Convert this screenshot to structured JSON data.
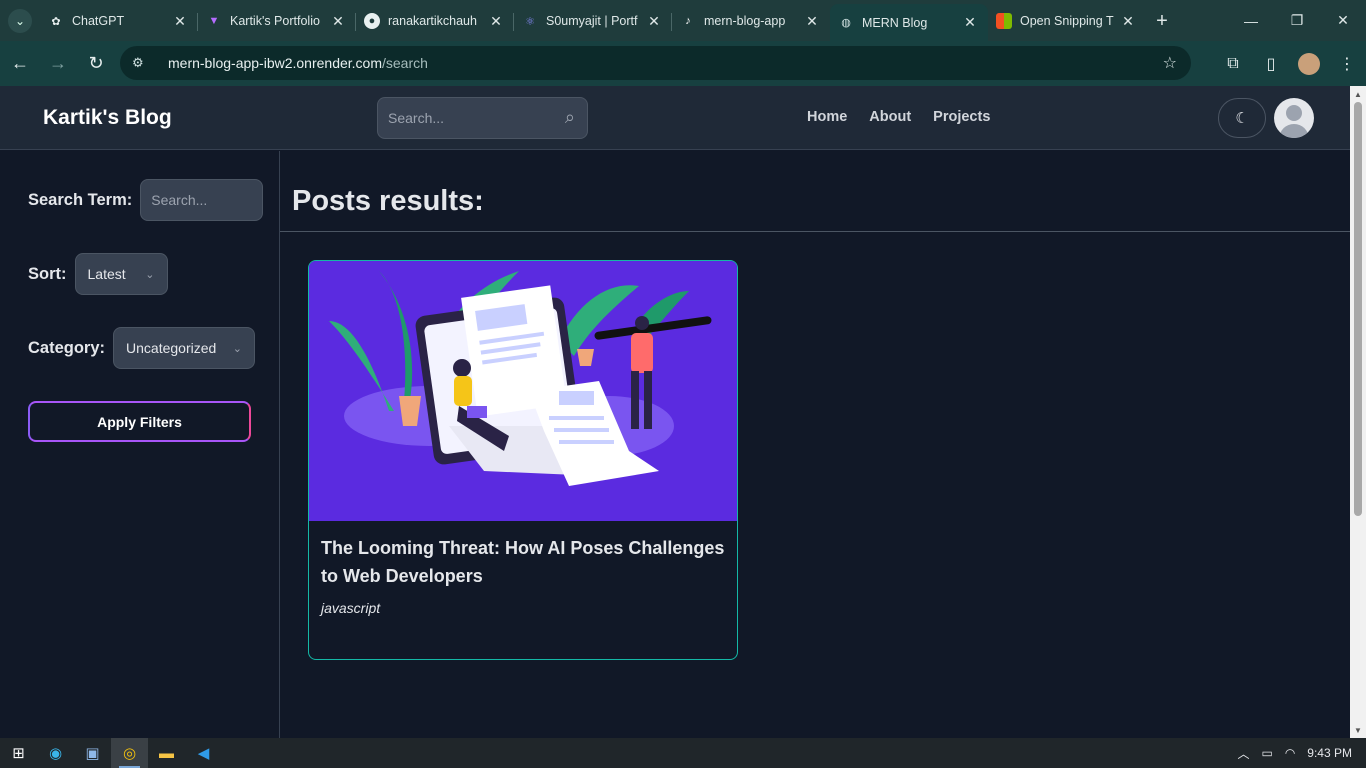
{
  "browser": {
    "tabs": [
      {
        "label": "ChatGPT",
        "icon": "chatgpt-icon",
        "active": false
      },
      {
        "label": "Kartik's Portfolio",
        "icon": "vite-icon",
        "active": false
      },
      {
        "label": "ranakartikchauh",
        "icon": "github-icon",
        "active": false
      },
      {
        "label": "S0umyajit | Portf",
        "icon": "react-icon",
        "active": false
      },
      {
        "label": "mern-blog-app",
        "icon": "render-icon",
        "active": false
      },
      {
        "label": "MERN Blog",
        "icon": "globe-icon",
        "active": true
      },
      {
        "label": "Open Snipping T",
        "icon": "microsoft-icon",
        "active": false
      }
    ],
    "url_host": "mern-blog-app-ibw2.onrender.com",
    "url_path": "/search"
  },
  "header": {
    "brand": "Kartik's Blog",
    "search_placeholder": "Search...",
    "nav": [
      "Home",
      "About",
      "Projects"
    ]
  },
  "sidebar": {
    "search_label": "Search Term:",
    "search_placeholder": "Search...",
    "sort_label": "Sort:",
    "sort_value": "Latest",
    "category_label": "Category:",
    "category_value": "Uncategorized",
    "apply_label": "Apply Filters"
  },
  "main": {
    "title": "Posts results:",
    "posts": [
      {
        "title": "The Looming Threat: How AI Poses Challenges to Web Developers",
        "category": "javascript"
      }
    ]
  },
  "taskbar": {
    "clock": "9:43 PM"
  },
  "colors": {
    "page_bg": "#111827",
    "header_bg": "#1f2937",
    "card_border": "#14b8a6",
    "image_bg": "#5b2be0",
    "button_gradient_start": "#8b5cf6",
    "button_gradient_end": "#ec4899"
  }
}
